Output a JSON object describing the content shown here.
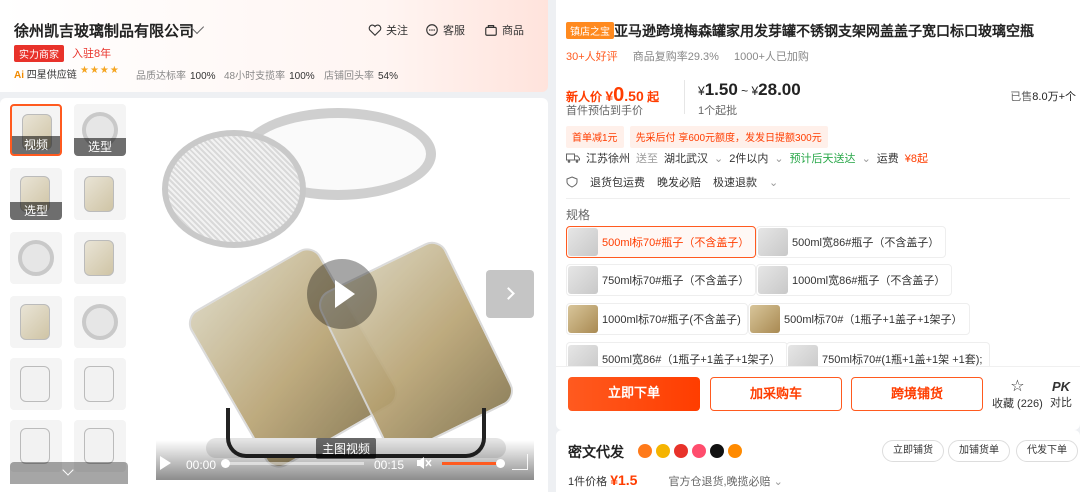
{
  "shop": {
    "name": "徐州凯吉玻璃制品有限公司",
    "badge": "实力商家",
    "join": "入驻8年",
    "ai_label": "四星供应链",
    "stars": "★★★★",
    "metrics": [
      {
        "label": "品质达标率",
        "value": "100%"
      },
      {
        "label": "48小时支揽率",
        "value": "100%"
      },
      {
        "label": "店铺回头率",
        "value": "54%"
      }
    ],
    "actions": {
      "follow": "关注",
      "service": "客服",
      "goods": "商品"
    }
  },
  "gallery": {
    "thumb_labels": {
      "video": "视频",
      "select1": "选型",
      "select2": "选型"
    },
    "main_label": "主图视频",
    "video": {
      "current": "00:00",
      "duration": "00:15"
    }
  },
  "product": {
    "tag": "镇店之宝",
    "title": "亚马逊跨境梅森罐家用发芽罐不锈钢支架网盖盖子宽口标口玻璃空瓶",
    "reviews": "30+人好评",
    "repurchase": "商品复购率29.3%",
    "purchased": "1000+人已加购",
    "new_price_label": "新人价",
    "new_price_currency": "¥",
    "new_price_int": "0",
    "new_price_dec": ".50",
    "new_price_suffix": "起",
    "first_price_label": "首件预估到手价",
    "range_prefix1": "¥",
    "range_low": "1.50",
    "range_sep": " ~ ",
    "range_prefix2": "¥",
    "range_high": "28.00",
    "moq": "1个起批",
    "sold_label": "已售",
    "sold_value": "8.0万+个",
    "promos": [
      "首单减1元",
      "先采后付 享600元额度，发发日提额300元"
    ],
    "ship": {
      "from": "江苏徐州",
      "send": "送至",
      "to": "湖北武汉",
      "qty": "2件以内",
      "eta": "预计后天送达",
      "fee_label": "运费",
      "fee": "¥8起"
    },
    "services": [
      "退货包运费",
      "晚发必赔",
      "极速退款"
    ],
    "spec_title": "规格",
    "options": [
      "500ml标70#瓶子（不含盖子）",
      "500ml宽86#瓶子（不含盖子）",
      "750ml标70#瓶子（不含盖子）",
      "1000ml宽86#瓶子（不含盖子）",
      "1000ml标70#瓶子(不含盖子)",
      "500ml标70#（1瓶子+1盖子+1架子）",
      "500ml宽86#（1瓶子+1盖子+1架子）",
      "750ml标70#(1瓶+1盖+1架 +1套);"
    ]
  },
  "buy": {
    "order": "立即下单",
    "cart": "加采购车",
    "cross": "跨境铺货",
    "fav": "收藏 (226)",
    "pk_title": "PK",
    "pk_label": "对比"
  },
  "bottom": {
    "title": "密文代发",
    "btns": [
      "立即铺货",
      "加铺货单",
      "代发下单"
    ],
    "price_label": "1件价格",
    "price": "¥1.5",
    "info": "官方仓退货,晚揽必赔"
  },
  "colors": {
    "accent": "#ff5a1f",
    "price": "#ff3d00",
    "green": "#2aa84a"
  }
}
